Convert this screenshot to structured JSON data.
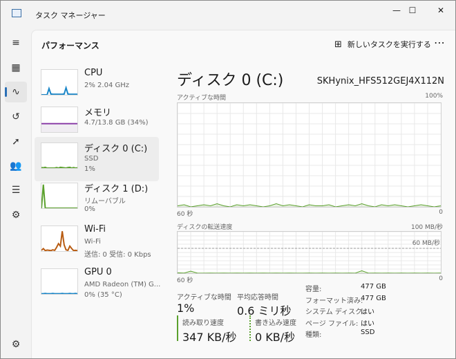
{
  "window": {
    "title": "タスク マネージャー",
    "minimize": "—",
    "maximize": "☐",
    "close": "✕"
  },
  "rail": {
    "items": [
      {
        "icon": "hamburger-icon",
        "glyph": "≡"
      },
      {
        "icon": "processes-icon",
        "glyph": "▦"
      },
      {
        "icon": "performance-icon",
        "glyph": "∿"
      },
      {
        "icon": "app-history-icon",
        "glyph": "↺"
      },
      {
        "icon": "startup-apps-icon",
        "glyph": "➚"
      },
      {
        "icon": "users-icon",
        "glyph": "👥"
      },
      {
        "icon": "details-icon",
        "glyph": "☰"
      },
      {
        "icon": "services-icon",
        "glyph": "⚙"
      }
    ],
    "settings_glyph": "⚙"
  },
  "header": {
    "title": "パフォーマンス",
    "new_task": "新しいタスクを実行する",
    "new_task_glyph": "⊞",
    "more": "⋯"
  },
  "sidebar": {
    "items": [
      {
        "name": "CPU",
        "line1": "2% 2.04 GHz",
        "line2": "",
        "color": "#1a86c8",
        "values": [
          0,
          0,
          0,
          0,
          25,
          3,
          2,
          2,
          2,
          2,
          2,
          2,
          3,
          28,
          3,
          2,
          2,
          2,
          2,
          2
        ]
      },
      {
        "name": "メモリ",
        "line1": "4.7/13.8 GB (34%)",
        "line2": "",
        "color": "#8b3fa8",
        "values": [
          34,
          34,
          34,
          34,
          34,
          34,
          34,
          34,
          34,
          34,
          34,
          34,
          34,
          34,
          34,
          34,
          34,
          34,
          34,
          34
        ]
      },
      {
        "name": "ディスク 0 (C:)",
        "line1": "SSD",
        "line2": "1%",
        "color": "#5aa02c",
        "values": [
          2,
          1,
          3,
          0,
          0,
          0,
          0,
          0,
          2,
          0,
          3,
          2,
          1,
          0,
          2,
          3,
          0,
          2,
          0,
          1
        ]
      },
      {
        "name": "ディスク 1 (D:)",
        "line1": "リムーバブル",
        "line2": "0%",
        "color": "#5aa02c",
        "values": [
          0,
          95,
          0,
          0,
          0,
          0,
          0,
          0,
          0,
          0,
          0,
          0,
          0,
          0,
          0,
          0,
          0,
          0,
          0,
          0
        ]
      },
      {
        "name": "Wi-Fi",
        "line1": "Wi-Fi",
        "line2": "送信: 0 受信: 0 Kbps",
        "color": "#b85c12",
        "values": [
          3,
          10,
          2,
          4,
          3,
          2,
          5,
          3,
          15,
          30,
          20,
          80,
          25,
          5,
          3,
          20,
          10,
          2,
          3,
          2
        ]
      },
      {
        "name": "GPU 0",
        "line1": "AMD Radeon (TM) G...",
        "line2": "0% (35 °C)",
        "color": "#1a86c8",
        "values": [
          1,
          1,
          2,
          1,
          1,
          1,
          2,
          1,
          1,
          1,
          1,
          2,
          1,
          1,
          1,
          2,
          1,
          1,
          2,
          1
        ]
      }
    ]
  },
  "main": {
    "title": "ディスク 0 (C:)",
    "model": "SKHynix_HFS512GEJ4X112N",
    "active_graph": {
      "label": "アクティブな時間",
      "max": "100%",
      "xleft": "60 秒",
      "xright": "0",
      "color": "#5aa02c",
      "values": [
        1,
        2,
        0,
        1,
        2,
        1,
        3,
        1,
        0,
        2,
        1,
        2,
        1,
        0,
        1,
        3,
        1,
        2,
        1,
        0,
        2,
        1,
        1,
        2,
        0,
        1,
        2,
        1,
        3,
        1,
        0,
        2,
        1,
        2,
        1,
        0,
        1,
        2,
        1,
        0,
        1
      ]
    },
    "transfer_graph": {
      "label": "ディスクの転送速度",
      "max": "100 MB/秒",
      "inner": "60 MB/秒",
      "xleft": "60 秒",
      "xright": "0",
      "color": "#5aa02c",
      "values": [
        1,
        0.5,
        5,
        0.5,
        0.3,
        0.5,
        0.3,
        0.5,
        0.3,
        0.5,
        0.3,
        0.5,
        0.3,
        0.5,
        0.3,
        0.5,
        0.3,
        0.5,
        0.3,
        0.3,
        0.5,
        0.3,
        0.5,
        0.3,
        0.5,
        0.3,
        0.5,
        0.3,
        6,
        0.3,
        0.5,
        0.3,
        0.5,
        0.3,
        0.5,
        0.3,
        0.5,
        0.3,
        0.5,
        0.3,
        0.5
      ]
    },
    "stats": {
      "active_label": "アクティブな時間",
      "active_value": "1%",
      "resp_label": "平均応答時間",
      "resp_value": "0.6 ミリ秒",
      "read_label": "読み取り速度",
      "read_value": "347 KB/秒",
      "write_label": "書き込み速度",
      "write_value": "0 KB/秒"
    },
    "props": [
      {
        "k": "容量:",
        "v": "477 GB"
      },
      {
        "k": "フォーマット済み:",
        "v": "477 GB"
      },
      {
        "k": "システム ディスク:",
        "v": "はい"
      },
      {
        "k": "ページ ファイル:",
        "v": "はい"
      },
      {
        "k": "種類:",
        "v": "SSD"
      }
    ]
  }
}
